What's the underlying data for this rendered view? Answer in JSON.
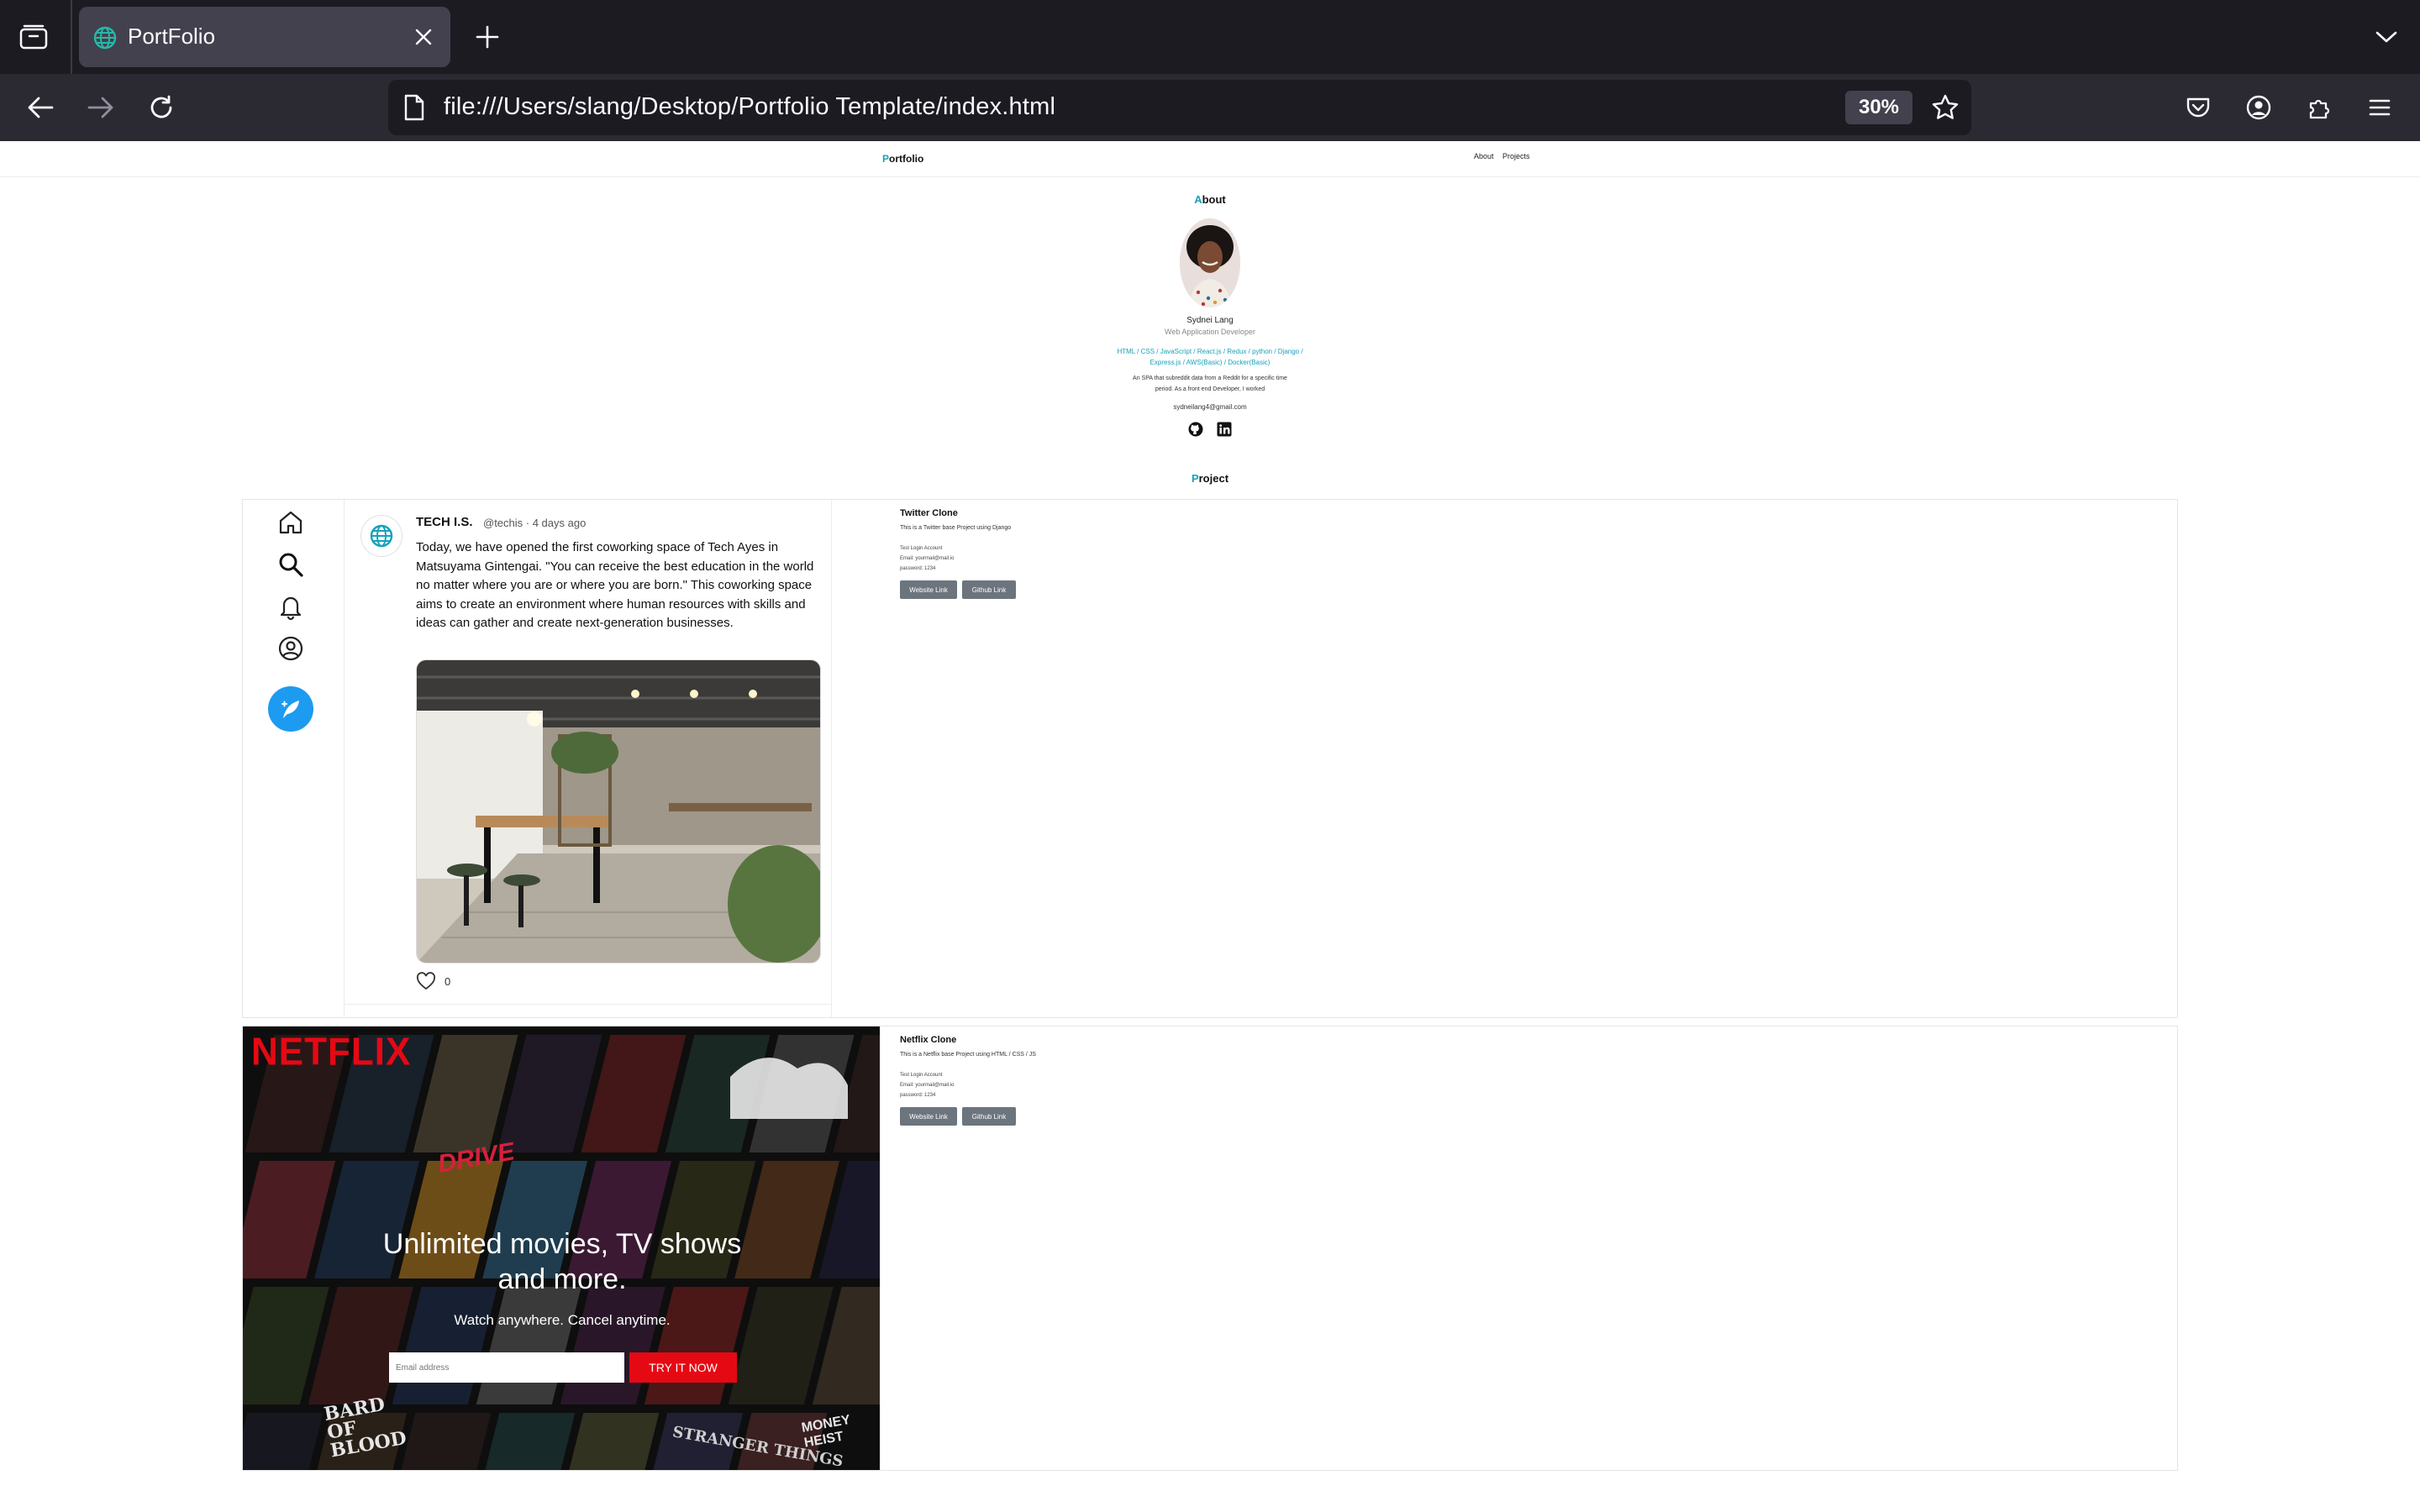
{
  "browser": {
    "tab_title": "PortFolio",
    "url": "file:///Users/slang/Desktop/Portfolio Template/index.html",
    "zoom": "30%"
  },
  "site": {
    "logo_first": "P",
    "logo_rest": "ortfolio",
    "nav": [
      "About",
      "Projects"
    ],
    "about_first": "A",
    "about_rest": "bout",
    "project_first": "P",
    "project_rest": "roject",
    "accent_color": "#17a2b8"
  },
  "profile": {
    "name": "Sydnei Lang",
    "role": "Web Application Developer",
    "skills_line1": "HTML / CSS / JavaScript / React.js / Redux / python / Django /",
    "skills_line2": "Express.js / AWS(Basic) / Docker(Basic)",
    "bio_line1": "An SPA that subreddit data from a Reddit for a specific time",
    "bio_line2": "period. As a front end Developer, I worked",
    "email": "sydneilang4@gmail.com"
  },
  "projects": [
    {
      "title": "Twitter Clone",
      "description": "This is a Twitter base Project using Django",
      "login_label": "Test Login Account",
      "email": "Email: yourmail@mail.io",
      "password": "password: 1234",
      "website_btn": "Website Link",
      "github_btn": "Github Link"
    },
    {
      "title": "Netflix Clone",
      "description": "This is a Netflix base Project using HTML / CSS / JS",
      "login_label": "Test Login Account",
      "email": "Email: yourmail@mail.io",
      "password": "password: 1234",
      "website_btn": "Website Link",
      "github_btn": "Github Link"
    }
  ],
  "twitter_preview": {
    "author": "TECH I.S.",
    "handle": "@techis · 4 days ago",
    "text": "Today, we have opened the first coworking space of Tech Ayes in Matsuyama Gintengai. \"You can receive the best education in the world no matter where you are or where you are born.\" This coworking space aims to create an environment where human resources with skills and ideas can gather and create next-generation businesses.",
    "likes": "0",
    "brand_color": "#1d9bf0"
  },
  "netflix_preview": {
    "logo": "NETFLIX",
    "headline": "Unlimited movies, TV shows and more.",
    "subline": "Watch anywhere. Cancel anytime.",
    "email_placeholder": "Email address",
    "cta": "TRY IT NOW",
    "poster_titles": [
      "DRIVE",
      "BARD OF BLOOD",
      "MONEY HEIST",
      "STRANGER THINGS"
    ],
    "brand_color": "#e50914"
  }
}
